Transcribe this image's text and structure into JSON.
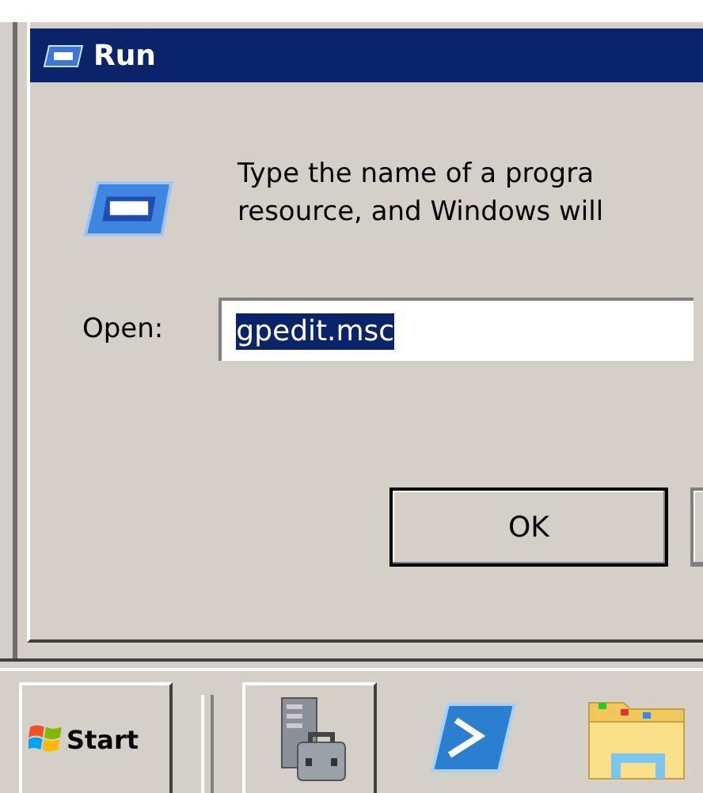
{
  "window": {
    "title": "Run"
  },
  "description_lines": [
    "Type the name of a progra",
    "resource, and Windows will"
  ],
  "open_field": {
    "label": "Open:",
    "value": "gpedit.msc",
    "text_selected": true
  },
  "buttons": [
    "OK"
  ],
  "taskbar": {
    "start_label": "Start",
    "items": [
      {
        "kind": "server",
        "framed": true
      },
      {
        "kind": "console",
        "framed": false
      },
      {
        "kind": "folder",
        "framed": false
      }
    ]
  }
}
